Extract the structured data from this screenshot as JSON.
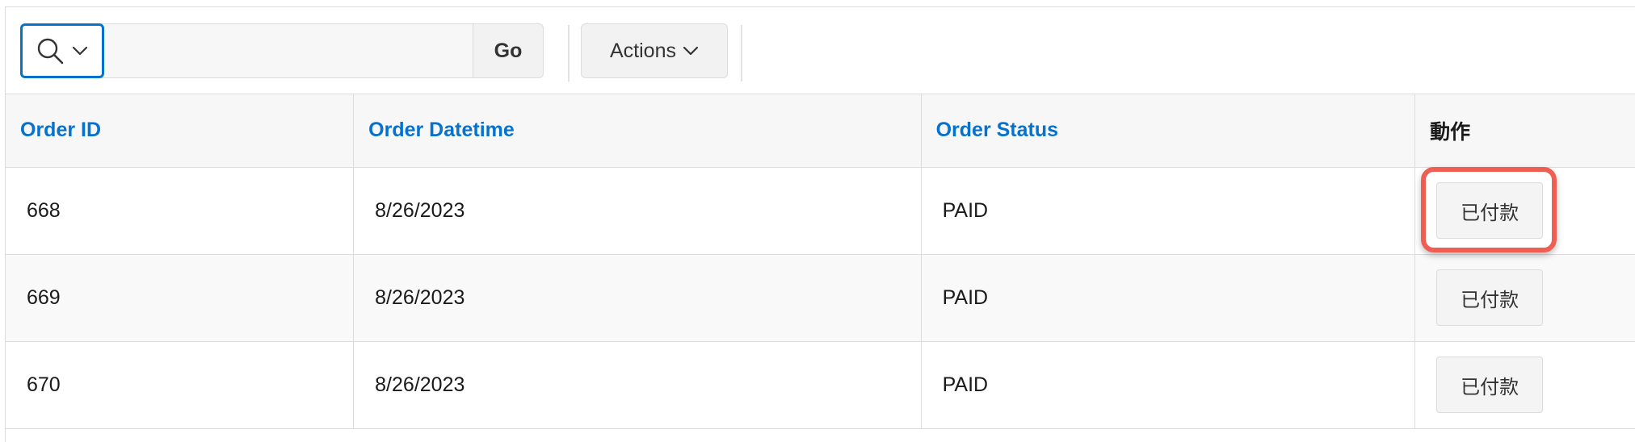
{
  "toolbar": {
    "search_placeholder": "",
    "search_value": "",
    "go_label": "Go",
    "actions_label": "Actions"
  },
  "table": {
    "headers": [
      {
        "label": "Order ID",
        "sortable": true
      },
      {
        "label": "Order Datetime",
        "sortable": true
      },
      {
        "label": "Order Status",
        "sortable": true
      },
      {
        "label": "動作",
        "sortable": false
      }
    ],
    "rows": [
      {
        "order_id": "668",
        "order_datetime": "8/26/2023",
        "order_status": "PAID",
        "action_label": "已付款",
        "highlighted": true
      },
      {
        "order_id": "669",
        "order_datetime": "8/26/2023",
        "order_status": "PAID",
        "action_label": "已付款",
        "highlighted": false
      },
      {
        "order_id": "670",
        "order_datetime": "8/26/2023",
        "order_status": "PAID",
        "action_label": "已付款",
        "highlighted": false
      }
    ]
  },
  "colors": {
    "link_blue": "#0572ce",
    "highlight_red": "#ef5e52"
  },
  "icons": {
    "search": "search-icon",
    "chevron": "chevron-down-icon"
  }
}
